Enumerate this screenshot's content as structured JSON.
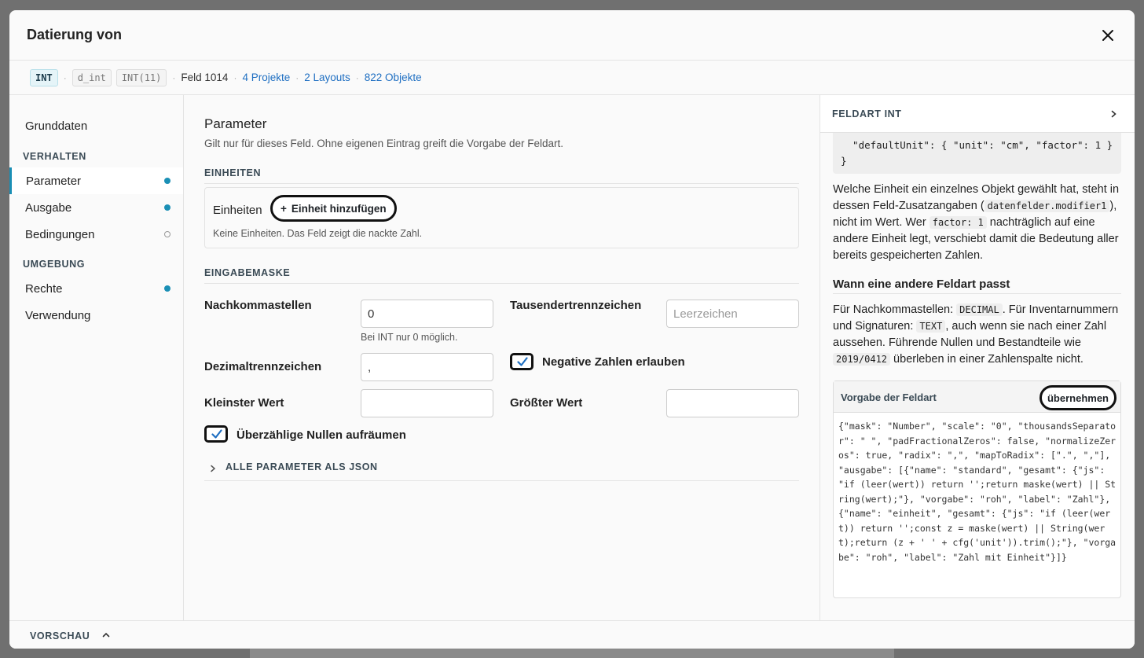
{
  "modal": {
    "title": "Datierung von"
  },
  "meta": {
    "type_chip": "INT",
    "name_chip": "d_int",
    "sql_chip": "INT(11)",
    "field_id": "Feld 1014",
    "projects_link": "4 Projekte",
    "layouts_link": "2 Layouts",
    "objects_link": "822 Objekte"
  },
  "sidebar": {
    "items": [
      {
        "label": "Grunddaten"
      },
      {
        "label": "Parameter",
        "dot": "filled"
      },
      {
        "label": "Ausgabe",
        "dot": "filled"
      },
      {
        "label": "Bedingungen",
        "dot": "empty"
      },
      {
        "label": "Rechte",
        "dot": "filled"
      },
      {
        "label": "Verwendung"
      }
    ],
    "sections": {
      "verhalten": "VERHALTEN",
      "umgebung": "UMGEBUNG"
    }
  },
  "main": {
    "title": "Parameter",
    "subtitle": "Gilt nur für dieses Feld. Ohne eigenen Eintrag greift die Vorgabe der Feldart.",
    "units_section": "EINHEITEN",
    "units_label": "Einheiten",
    "add_unit_button": "Einheit hinzufügen",
    "units_empty": "Keine Einheiten. Das Feld zeigt die nackte Zahl.",
    "mask_section": "EINGABEMASKE",
    "fields": {
      "nachkommastellen_label": "Nachkommastellen",
      "nachkommastellen_value": "0",
      "nachkommastellen_hint": "Bei INT nur 0 möglich.",
      "tausender_label": "Tausendertrennzeichen",
      "tausender_placeholder": "Leerzeichen",
      "dezimal_label": "Dezimaltrennzeichen",
      "dezimal_value": ",",
      "negative_label": "Negative Zahlen erlauben",
      "negative_checked": true,
      "kleinster_label": "Kleinster Wert",
      "kleinster_value": "",
      "groesster_label": "Größter Wert",
      "groesster_value": "",
      "nullen_label": "Überzählige Nullen aufräumen",
      "nullen_checked": true
    },
    "json_toggle": "ALLE PARAMETER ALS JSON"
  },
  "right": {
    "header": "FELDART INT",
    "code_fragment": "  \"defaultUnit\": { \"unit\": \"cm\", \"factor\": 1 }\n}",
    "para1": {
      "t1": "Welche Einheit ein einzelnes Objekt gewählt hat, steht in dessen Feld-Zusatzangaben (",
      "c1": "datenfelder.modifier1",
      "t2": "), nicht im Wert. Wer ",
      "c2": "factor: 1",
      "t3": " nachträglich auf eine andere Einheit legt, verschiebt damit die Bedeutung aller bereits gespeicherten Zahlen."
    },
    "heading": "Wann eine andere Feldart passt",
    "para2": {
      "t1": "Für Nachkommastellen: ",
      "c1": "DECIMAL",
      "t2": ". Für Inventarnummern und Signaturen: ",
      "c2": "TEXT",
      "t3": ", auch wenn sie nach einer Zahl aussehen. Führende Nullen und Bestandteile wie ",
      "c3": "2019/0412",
      "t4": " überleben in einer Zahlenspalte nicht."
    },
    "vorgabe_title": "Vorgabe der Feldart",
    "apply_button": "übernehmen",
    "vorgabe_json": "{\"mask\": \"Number\", \"scale\": \"0\", \"thousandsSeparator\": \" \", \"padFractionalZeros\": false, \"normalizeZeros\": true, \"radix\": \",\", \"mapToRadix\": [\".\", \",\"], \"ausgabe\": [{\"name\": \"standard\", \"gesamt\": {\"js\": \"if (leer(wert)) return '';return maske(wert) || String(wert);\"}, \"vorgabe\": \"roh\", \"label\": \"Zahl\"}, {\"name\": \"einheit\", \"gesamt\": {\"js\": \"if (leer(wert)) return '';const z = maske(wert) || String(wert);return (z + ' ' + cfg('unit')).trim();\"}, \"vorgabe\": \"roh\", \"label\": \"Zahl mit Einheit\"}]}"
  },
  "footer": {
    "label": "VORSCHAU"
  }
}
